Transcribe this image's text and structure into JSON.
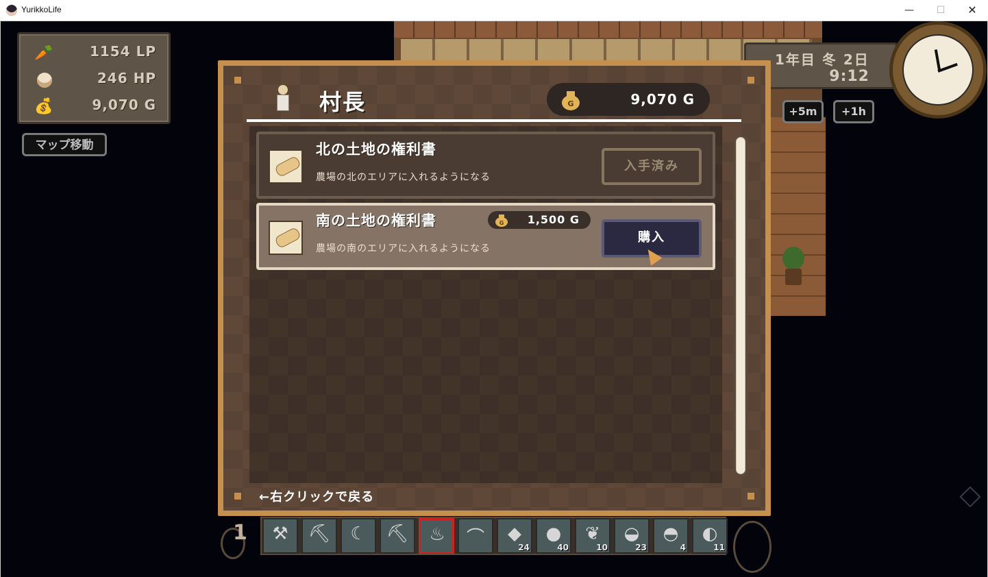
{
  "window": {
    "title": "YurikkoLife",
    "minimize": "—",
    "maximize": "☐",
    "close": "✕"
  },
  "status": {
    "lp": "1154 LP",
    "hp": "246 HP",
    "gold": "9,070 G"
  },
  "map_button": "マップ移動",
  "datetime": {
    "date": "1年目 冬 2日",
    "time": "9:12"
  },
  "time_buttons": {
    "plus5m": "+5m",
    "plus1h": "+1h"
  },
  "dialog": {
    "npc_name": "村長",
    "money": "9,070 G",
    "items": [
      {
        "name": "北の土地の権利書",
        "desc": "農場の北のエリアに入れるようになる",
        "action": "入手済み",
        "icon": "deed-scroll-icon"
      },
      {
        "name": "南の土地の権利書",
        "desc": "農場の南のエリアに入れるようになる",
        "price": "1,500 G",
        "action": "購入",
        "icon": "deed-scroll-icon"
      }
    ],
    "back_hint": "←右クリックで戻る"
  },
  "hotbar": {
    "number": "1",
    "slots": [
      {
        "icon": "hammer-icon",
        "glyph": "⚒",
        "count": ""
      },
      {
        "icon": "pickaxe-icon",
        "glyph": "⛏",
        "count": ""
      },
      {
        "icon": "sickle-icon",
        "glyph": "☾",
        "count": ""
      },
      {
        "icon": "hoe-icon",
        "glyph": "⛏",
        "count": ""
      },
      {
        "icon": "watering-can-icon",
        "glyph": "♨",
        "count": ""
      },
      {
        "icon": "fishing-rod-icon",
        "glyph": "⌒",
        "count": ""
      },
      {
        "icon": "stone-shard-icon",
        "glyph": "◆",
        "count": "24"
      },
      {
        "icon": "coal-icon",
        "glyph": "●",
        "count": "40"
      },
      {
        "icon": "bean-pod-icon",
        "glyph": "❦",
        "count": "10"
      },
      {
        "icon": "silver-ore-icon",
        "glyph": "◒",
        "count": "23"
      },
      {
        "icon": "gold-ore-icon",
        "glyph": "◓",
        "count": "4"
      },
      {
        "icon": "crystal-ore-icon",
        "glyph": "◐",
        "count": "11"
      }
    ]
  },
  "colors": {
    "frame": "#c58f4e",
    "selected_slot": "#cc2222",
    "buy_button": "#2b2942"
  }
}
